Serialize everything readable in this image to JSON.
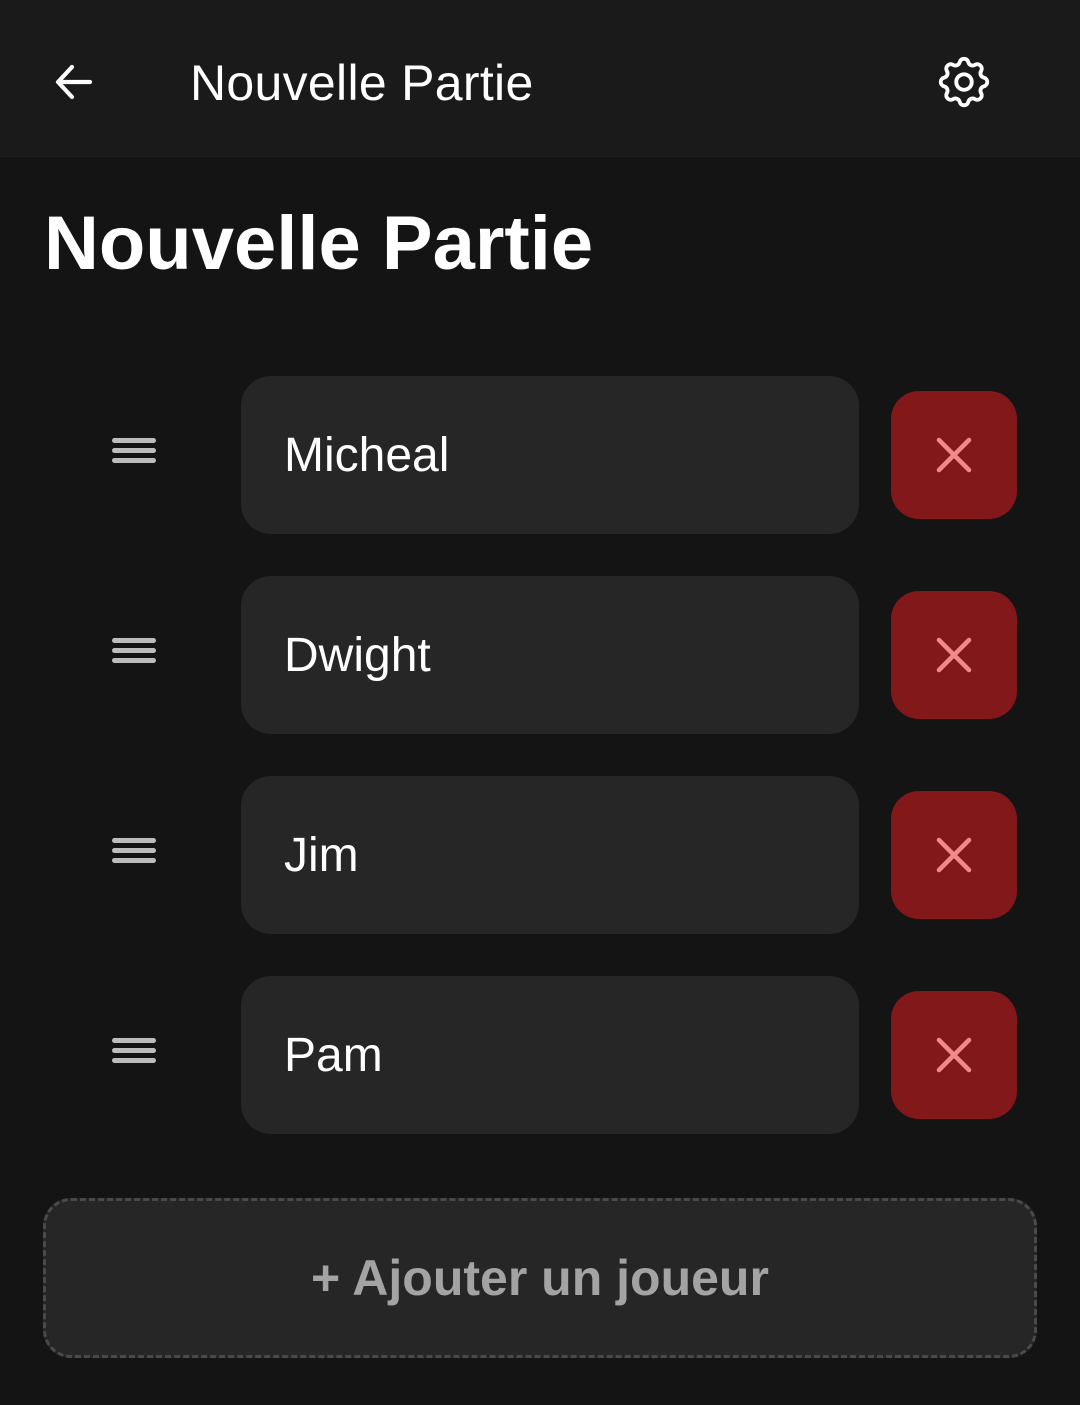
{
  "header": {
    "title": "Nouvelle Partie",
    "back_icon": "arrow-left-icon",
    "settings_icon": "gear-icon"
  },
  "page": {
    "title": "Nouvelle Partie"
  },
  "players": [
    {
      "name": "Micheal"
    },
    {
      "name": "Dwight"
    },
    {
      "name": "Jim"
    },
    {
      "name": "Pam"
    }
  ],
  "add_player": {
    "label": "+ Ajouter un joueur"
  },
  "colors": {
    "background": "#141414",
    "surface": "#262627",
    "remove_button": "#83181b",
    "remove_icon": "#f08a8a",
    "muted_text": "#a3a3a3"
  }
}
